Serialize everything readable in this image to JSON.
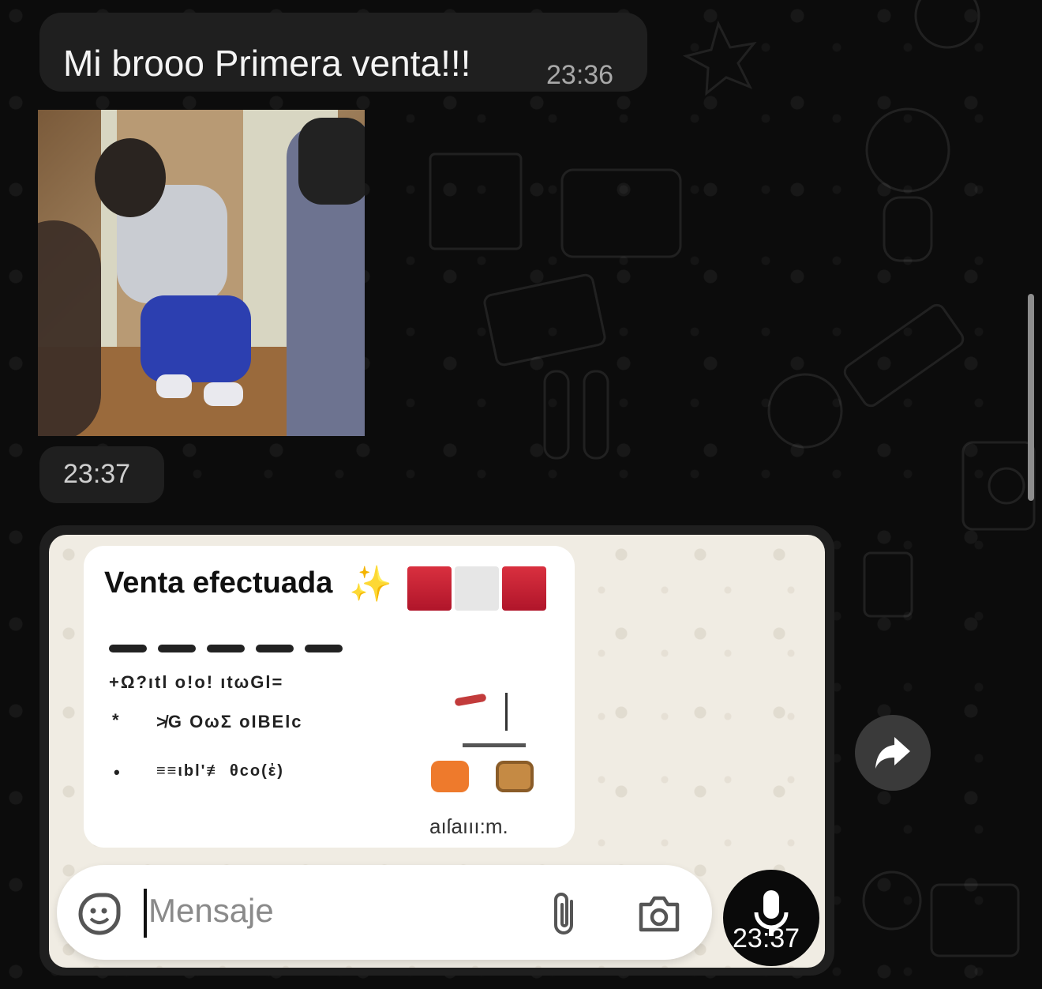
{
  "messages": [
    {
      "type": "text",
      "text": "Mi brooo Primera venta!!!",
      "time": "23:36"
    },
    {
      "type": "photo",
      "time": "23:37"
    },
    {
      "type": "screenshot",
      "time": "23:37",
      "card": {
        "title": "Venta efectuada",
        "row1": "+Ω?ıtl  o!o!  ıtωGl=",
        "row2_bullet": "*",
        "row2": "≯G  OωΣ  οΙΒΕlc",
        "row3_bullet": "•",
        "row3": "≡≡ιbl'≢  θco(ἐ)",
        "footer": "aıſaııı:m."
      },
      "composer": {
        "placeholder": "Mensaje"
      }
    }
  ],
  "icons": [
    "forward-icon",
    "mic-icon",
    "sticker-icon",
    "attach-icon",
    "camera-icon",
    "sparkles-icon"
  ],
  "colors": {
    "bubble": "#1f1f1f",
    "background": "#0c0c0c",
    "composer": "#ffffff"
  }
}
